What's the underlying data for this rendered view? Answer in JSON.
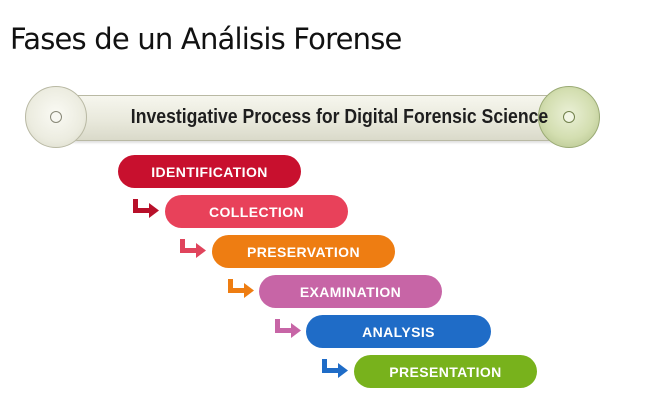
{
  "slide": {
    "title": "Fases de un Análisis Forense"
  },
  "banner": {
    "text": "Investigative Process for Digital Forensic Science"
  },
  "steps": [
    {
      "label": "IDENTIFICATION",
      "color": "#c8102e"
    },
    {
      "label": "COLLECTION",
      "color": "#e8415a"
    },
    {
      "label": "PRESERVATION",
      "color": "#ee7d12"
    },
    {
      "label": "EXAMINATION",
      "color": "#c765a6"
    },
    {
      "label": "ANALYSIS",
      "color": "#1f6cc7"
    },
    {
      "label": "PRESENTATION",
      "color": "#78b21c"
    }
  ],
  "arrows": [
    {
      "icon": "down-right-arrow-icon",
      "color": "#b8102a"
    },
    {
      "icon": "down-right-arrow-icon",
      "color": "#e0445c"
    },
    {
      "icon": "down-right-arrow-icon",
      "color": "#ee7d12"
    },
    {
      "icon": "down-right-arrow-icon",
      "color": "#c765a6"
    },
    {
      "icon": "down-right-arrow-icon",
      "color": "#1f6cc7"
    }
  ]
}
